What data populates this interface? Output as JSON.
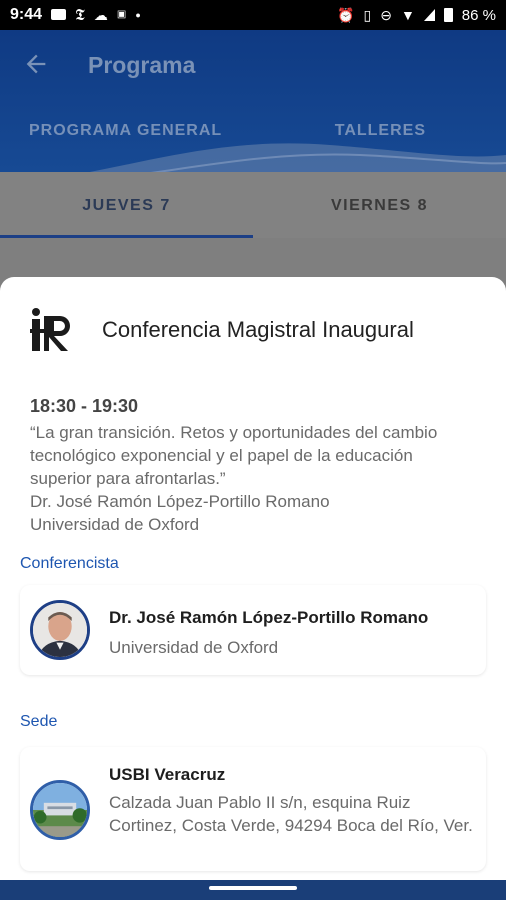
{
  "status_bar": {
    "time": "9:44",
    "battery": "86 %"
  },
  "header": {
    "title": "Programa",
    "tabs": [
      "PROGRAMA GENERAL",
      "TALLERES"
    ]
  },
  "day_tabs": [
    "JUEVES 7",
    "VIERNES 8"
  ],
  "event": {
    "title": "Conferencia Magistral Inaugural",
    "time": "18:30 - 19:30",
    "description": "“La gran transición. Retos y oportunidades del cambio tecnológico exponencial y el papel de la educación superior para afrontarlas.”",
    "speaker_line": "Dr. José Ramón López-Portillo Romano",
    "institution_line": "Universidad de Oxford"
  },
  "speaker_section": {
    "label": "Conferencista",
    "name": "Dr. José Ramón López-Portillo Romano",
    "affiliation": "Universidad de Oxford"
  },
  "venue_section": {
    "label": "Sede",
    "name": "USBI Veracruz",
    "address": "Calzada Juan Pablo II s/n, esquina Ruiz Cortinez, Costa Verde, 94294 Boca del Río, Ver."
  },
  "colors": {
    "primary": "#1c3f86",
    "accent_link": "#1e56b0",
    "scrim": "#7f7f7f"
  }
}
